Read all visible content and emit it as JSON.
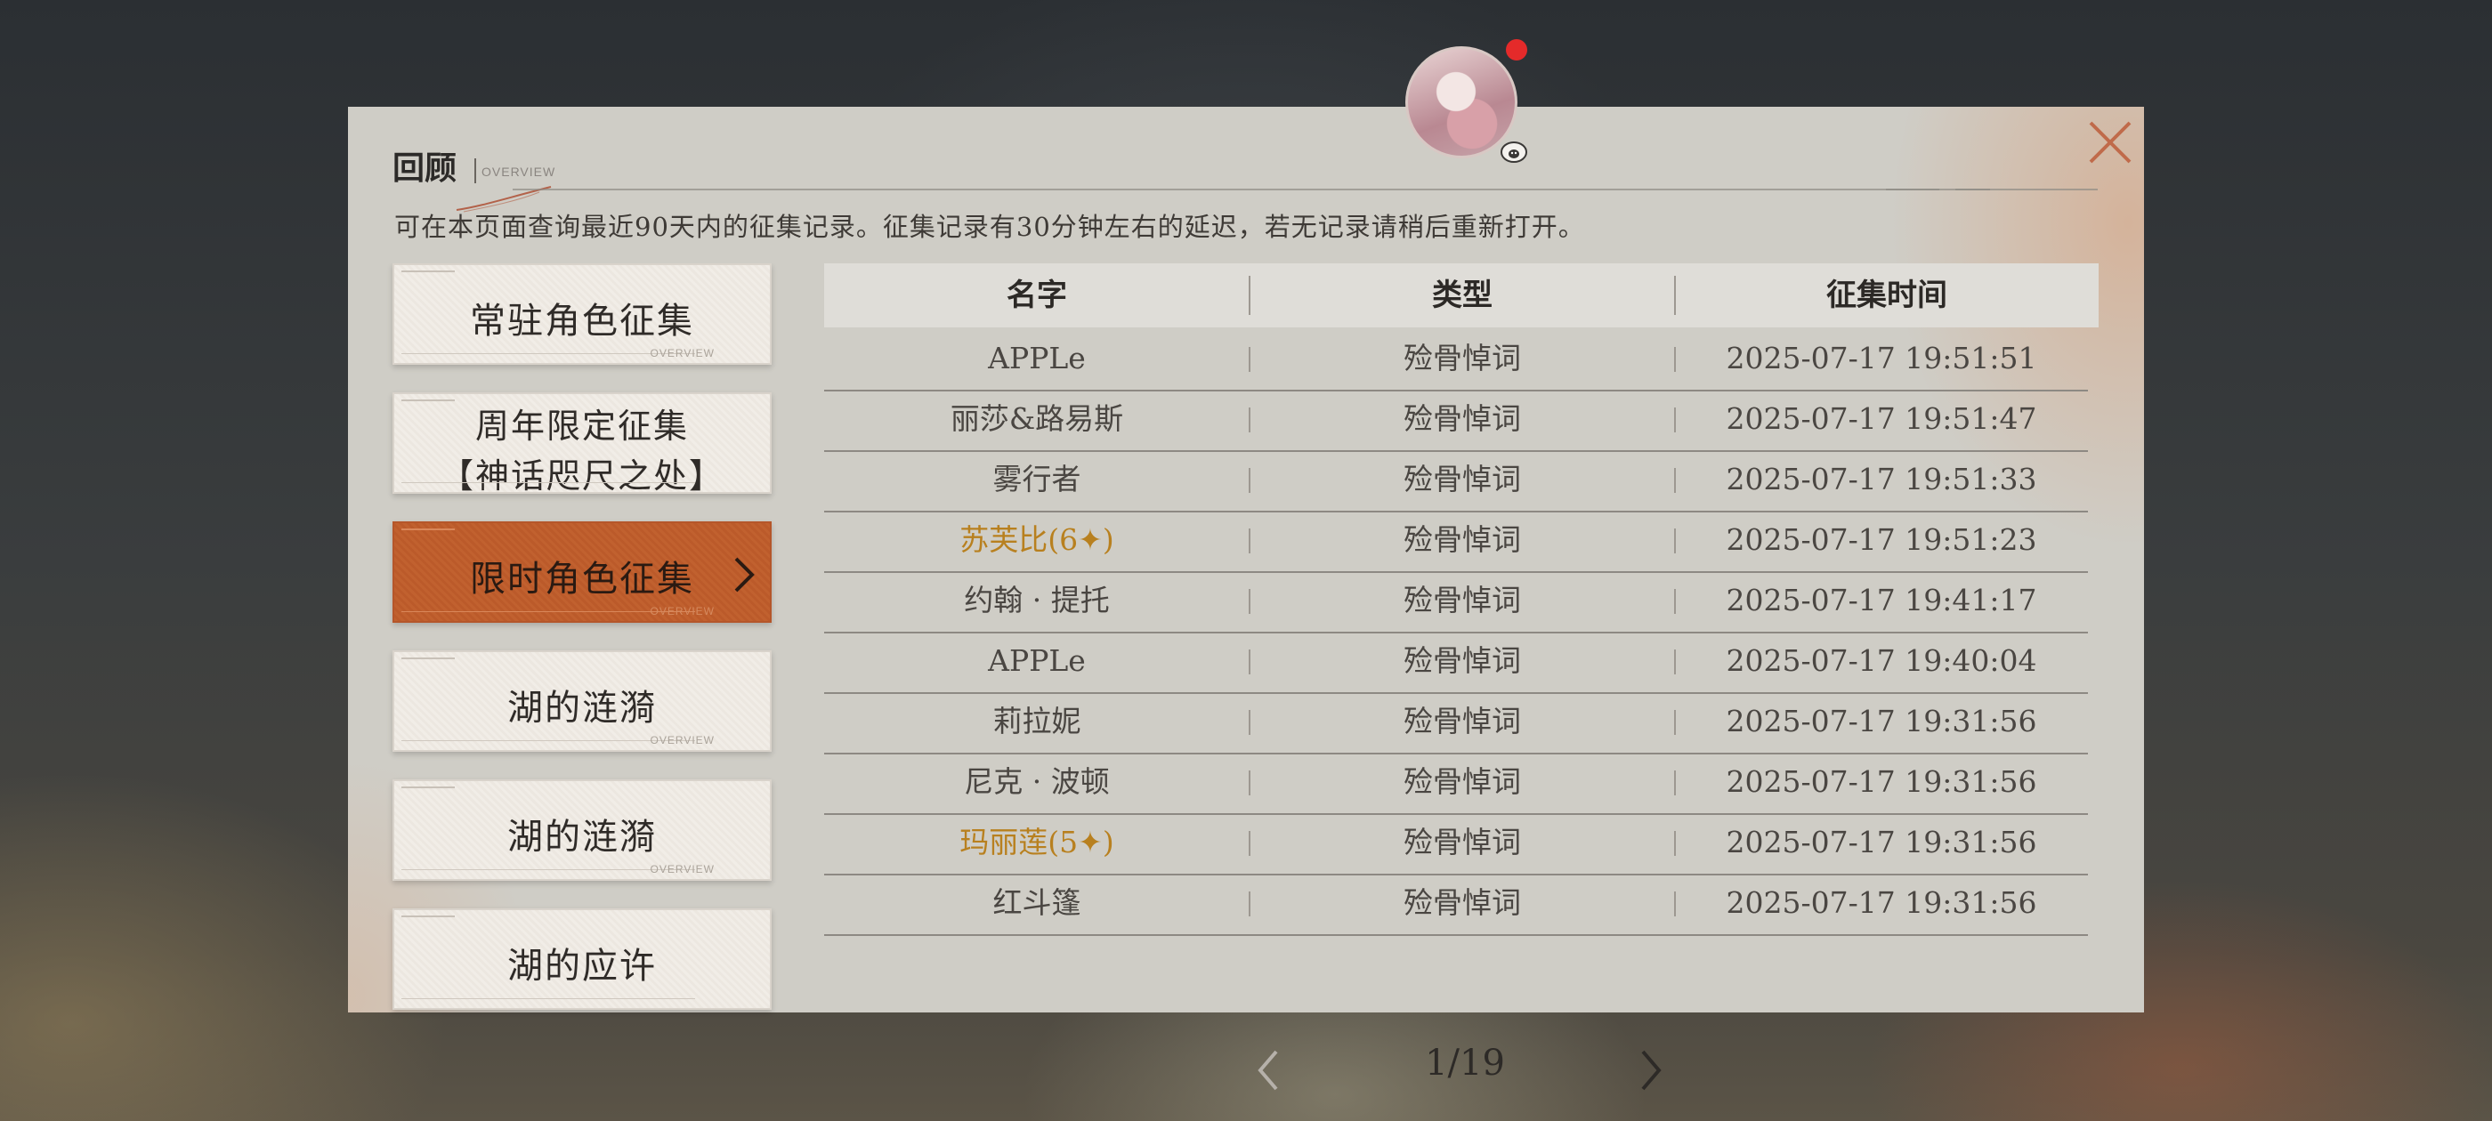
{
  "header": {
    "title": "回顾",
    "subtitle": "OVERVIEW",
    "notice": "可在本页面查询最近90天内的征集记录。征集记录有30分钟左右的延迟，若无记录请稍后重新打开。"
  },
  "sidebar": {
    "items": [
      {
        "label": "常驻角色征集",
        "active": false
      },
      {
        "label": "周年限定征集\n【神话咫尺之处】",
        "active": false
      },
      {
        "label": "限时角色征集",
        "active": true
      },
      {
        "label": "湖的涟漪",
        "active": false
      },
      {
        "label": "湖的涟漪",
        "active": false
      },
      {
        "label": "湖的应许",
        "active": false
      }
    ],
    "card_tag": "OVERVIEW"
  },
  "table": {
    "headers": [
      "名字",
      "类型",
      "征集时间"
    ],
    "rows": [
      {
        "name": "APPLe",
        "type": "殓骨悼词",
        "time": "2025-07-17 19:51:51",
        "rarity": "normal"
      },
      {
        "name": "丽莎&路易斯",
        "type": "殓骨悼词",
        "time": "2025-07-17 19:51:47",
        "rarity": "normal"
      },
      {
        "name": "雾行者",
        "type": "殓骨悼词",
        "time": "2025-07-17 19:51:33",
        "rarity": "normal"
      },
      {
        "name": "苏芙比(6✦)",
        "type": "殓骨悼词",
        "time": "2025-07-17 19:51:23",
        "rarity": "six"
      },
      {
        "name": "约翰 · 提托",
        "type": "殓骨悼词",
        "time": "2025-07-17 19:41:17",
        "rarity": "normal"
      },
      {
        "name": "APPLe",
        "type": "殓骨悼词",
        "time": "2025-07-17 19:40:04",
        "rarity": "normal"
      },
      {
        "name": "莉拉妮",
        "type": "殓骨悼词",
        "time": "2025-07-17 19:31:56",
        "rarity": "normal"
      },
      {
        "name": "尼克 · 波顿",
        "type": "殓骨悼词",
        "time": "2025-07-17 19:31:56",
        "rarity": "normal"
      },
      {
        "name": "玛丽莲(5✦)",
        "type": "殓骨悼词",
        "time": "2025-07-17 19:31:56",
        "rarity": "five"
      },
      {
        "name": "红斗篷",
        "type": "殓骨悼词",
        "time": "2025-07-17 19:31:56",
        "rarity": "normal"
      }
    ]
  },
  "pagination": {
    "text": "1/19",
    "current": 1,
    "total": 19
  },
  "colors": {
    "accent": "#c1612f",
    "six_star": "#b8801f",
    "five_star": "#b8801f",
    "notification_dot": "#e52a2a"
  },
  "icons": {
    "close": "close-icon",
    "prev": "chevron-left-icon",
    "next": "chevron-right-icon",
    "active_chevron": "chevron-right-icon",
    "pet": "sheep-icon"
  }
}
